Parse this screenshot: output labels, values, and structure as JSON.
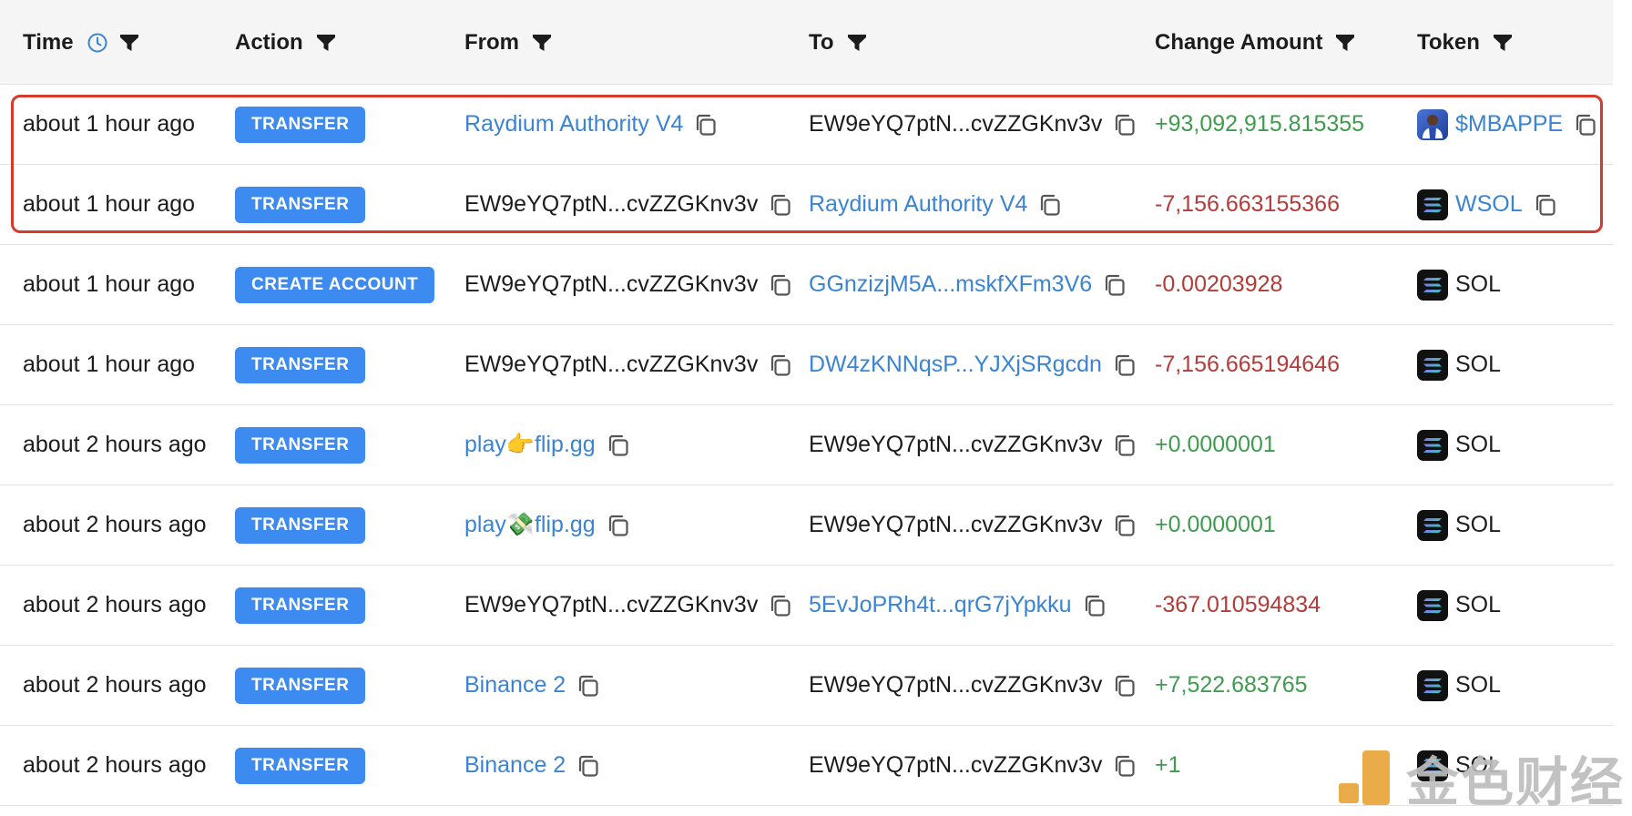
{
  "header": {
    "time": "Time",
    "action": "Action",
    "from": "From",
    "to": "To",
    "change_amount": "Change Amount",
    "token": "Token"
  },
  "rows": [
    {
      "time": "about 1 hour ago",
      "action": "TRANSFER",
      "from": "Raydium Authority V4",
      "from_link": true,
      "to": "EW9eYQ7ptN...cvZZGKnv3v",
      "to_link": false,
      "amount": "+93,092,915.815355",
      "amount_sign": "pos",
      "token": "$MBAPPE",
      "token_link": true,
      "token_icon": "mbappe-token-icon",
      "token_copy": true
    },
    {
      "time": "about 1 hour ago",
      "action": "TRANSFER",
      "from": "EW9eYQ7ptN...cvZZGKnv3v",
      "from_link": false,
      "to": "Raydium Authority V4",
      "to_link": true,
      "amount": "-7,156.663155366",
      "amount_sign": "neg",
      "token": "WSOL",
      "token_link": true,
      "token_icon": "solana-icon",
      "token_copy": true
    },
    {
      "time": "about 1 hour ago",
      "action": "CREATE ACCOUNT",
      "from": "EW9eYQ7ptN...cvZZGKnv3v",
      "from_link": false,
      "to": "GGnzizjM5A...mskfXFm3V6",
      "to_link": true,
      "amount": "-0.00203928",
      "amount_sign": "neg",
      "token": "SOL",
      "token_link": false,
      "token_icon": "solana-icon",
      "token_copy": false
    },
    {
      "time": "about 1 hour ago",
      "action": "TRANSFER",
      "from": "EW9eYQ7ptN...cvZZGKnv3v",
      "from_link": false,
      "to": "DW4zKNNqsP...YJXjSRgcdn",
      "to_link": true,
      "amount": "-7,156.665194646",
      "amount_sign": "neg",
      "token": "SOL",
      "token_link": false,
      "token_icon": "solana-icon",
      "token_copy": false
    },
    {
      "time": "about 2 hours ago",
      "action": "TRANSFER",
      "from": "play👉flip.gg",
      "from_link": true,
      "to": "EW9eYQ7ptN...cvZZGKnv3v",
      "to_link": false,
      "amount": "+0.0000001",
      "amount_sign": "pos",
      "token": "SOL",
      "token_link": false,
      "token_icon": "solana-icon",
      "token_copy": false
    },
    {
      "time": "about 2 hours ago",
      "action": "TRANSFER",
      "from": "play💸flip.gg",
      "from_link": true,
      "to": "EW9eYQ7ptN...cvZZGKnv3v",
      "to_link": false,
      "amount": "+0.0000001",
      "amount_sign": "pos",
      "token": "SOL",
      "token_link": false,
      "token_icon": "solana-icon",
      "token_copy": false
    },
    {
      "time": "about 2 hours ago",
      "action": "TRANSFER",
      "from": "EW9eYQ7ptN...cvZZGKnv3v",
      "from_link": false,
      "to": "5EvJoPRh4t...qrG7jYpkku",
      "to_link": true,
      "amount": "-367.010594834",
      "amount_sign": "neg",
      "token": "SOL",
      "token_link": false,
      "token_icon": "solana-icon",
      "token_copy": false
    },
    {
      "time": "about 2 hours ago",
      "action": "TRANSFER",
      "from": "Binance 2",
      "from_link": true,
      "to": "EW9eYQ7ptN...cvZZGKnv3v",
      "to_link": false,
      "amount": "+7,522.683765",
      "amount_sign": "pos",
      "token": "SOL",
      "token_link": false,
      "token_icon": "solana-icon",
      "token_copy": false
    },
    {
      "time": "about 2 hours ago",
      "action": "TRANSFER",
      "from": "Binance 2",
      "from_link": true,
      "to": "EW9eYQ7ptN...cvZZGKnv3v",
      "to_link": false,
      "amount": "+1",
      "amount_sign": "pos",
      "token": "SOL",
      "token_link": false,
      "token_icon": "solana-icon",
      "token_copy": false
    }
  ],
  "watermark": {
    "text": "金色财经"
  },
  "colors": {
    "badge": "#3d8bf0",
    "link": "#3a84d6",
    "positive": "#3f9b4e",
    "negative": "#b43b39",
    "highlight": "#d63a2b"
  }
}
